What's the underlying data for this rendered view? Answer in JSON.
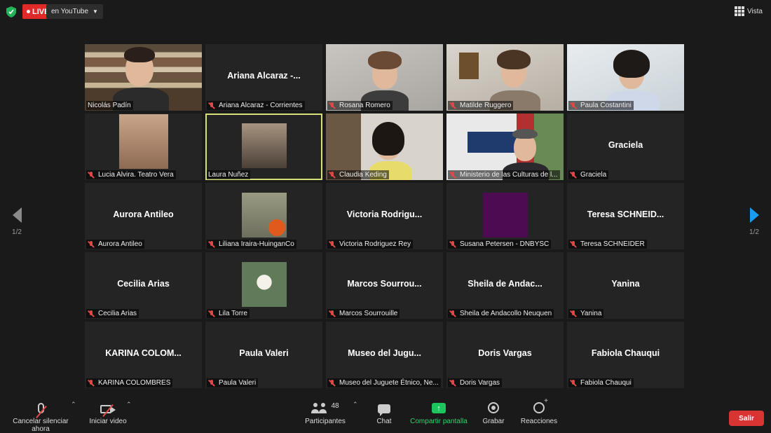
{
  "top_bar": {
    "live_label": "LIVE",
    "stream_target": "en YouTube",
    "view_label": "Vista"
  },
  "pagination": {
    "left_label": "1/2",
    "right_label": "1/2"
  },
  "tiles": [
    {
      "display": "",
      "label": "Nicolás Padín"
    },
    {
      "display": "Ariana  Alcaraz -...",
      "label": "Ariana Alcaraz - Corrientes"
    },
    {
      "display": "",
      "label": "Rosana Romero"
    },
    {
      "display": "",
      "label": "Matilde Ruggero"
    },
    {
      "display": "",
      "label": "Paula Costantini"
    },
    {
      "display": "",
      "label": "Lucia Alvira. Teatro Vera"
    },
    {
      "display": "",
      "label": "Laura Nuñez"
    },
    {
      "display": "",
      "label": "Claudia Keding"
    },
    {
      "display": "",
      "label": "Ministerio de las Culturas de l..."
    },
    {
      "display": "Graciela",
      "label": "Graciela"
    },
    {
      "display": "Aurora Antileo",
      "label": "Aurora Antileo"
    },
    {
      "display": "",
      "label": "Liliana Iraira-HuinganCo"
    },
    {
      "display": "Victoria  Rodrigu...",
      "label": "Victoria Rodriguez Rey"
    },
    {
      "display": "",
      "label": "Susana Petersen - DNBYSC"
    },
    {
      "display": "Teresa  SCHNEID...",
      "label": "Teresa SCHNEIDER"
    },
    {
      "display": "Cecilia Arias",
      "label": "Cecilia Arias"
    },
    {
      "display": "",
      "label": "Lila Torre"
    },
    {
      "display": "Marcos  Sourrou...",
      "label": "Marcos Sourrouille"
    },
    {
      "display": "Sheila  de  Andac...",
      "label": "Sheila de Andacollo Neuquen"
    },
    {
      "display": "Yanina",
      "label": "Yanina"
    },
    {
      "display": "KARINA  COLOM...",
      "label": "KARINA COLOMBRES"
    },
    {
      "display": "Paula Valeri",
      "label": "Paula Valeri"
    },
    {
      "display": "Museo  del  Jugu...",
      "label": "Museo del Juguete Étnico, Ne..."
    },
    {
      "display": "Doris Vargas",
      "label": "Doris Vargas"
    },
    {
      "display": "Fabiola Chauqui",
      "label": "Fabiola Chauqui"
    }
  ],
  "toolbar": {
    "unmute_label": "Cancelar silenciar ahora",
    "video_label": "Iniciar video",
    "participants_label": "Participantes",
    "participants_count": "48",
    "chat_label": "Chat",
    "share_label": "Compartir pantalla",
    "record_label": "Grabar",
    "reactions_label": "Reacciones",
    "leave_label": "Salir"
  },
  "colors": {
    "live_red": "#e02a2a",
    "active_speaker": "#d8e07a",
    "share_green": "#1cc65c",
    "leave_red": "#d83434",
    "muted_red": "#e04848"
  }
}
